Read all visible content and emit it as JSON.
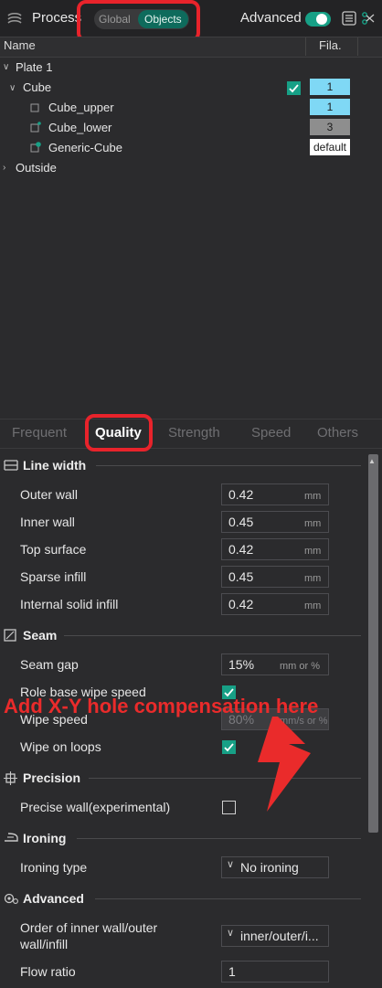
{
  "header": {
    "title": "Process",
    "toggle": {
      "global": "Global",
      "objects": "Objects"
    },
    "advanced_label": "Advanced"
  },
  "tree": {
    "columns": {
      "name": "Name",
      "fila": "Fila."
    },
    "rows": [
      {
        "label": "Plate 1",
        "fila": ""
      },
      {
        "label": "Cube",
        "fila": "1"
      },
      {
        "label": "Cube_upper",
        "fila": "1"
      },
      {
        "label": "Cube_lower",
        "fila": "3"
      },
      {
        "label": "Generic-Cube",
        "fila": "default"
      },
      {
        "label": "Outside",
        "fila": ""
      }
    ]
  },
  "tabs": [
    "Frequent",
    "Quality",
    "Strength",
    "Speed",
    "Others"
  ],
  "sections": {
    "line_width": {
      "title": "Line width",
      "options": [
        {
          "label": "Outer wall",
          "value": "0.42",
          "unit": "mm"
        },
        {
          "label": "Inner wall",
          "value": "0.45",
          "unit": "mm"
        },
        {
          "label": "Top surface",
          "value": "0.42",
          "unit": "mm"
        },
        {
          "label": "Sparse infill",
          "value": "0.45",
          "unit": "mm"
        },
        {
          "label": "Internal solid infill",
          "value": "0.42",
          "unit": "mm"
        }
      ]
    },
    "seam": {
      "title": "Seam",
      "seam_gap": {
        "label": "Seam gap",
        "value": "15%",
        "unit": "mm or %"
      },
      "role_base": {
        "label": "Role base wipe speed"
      },
      "wipe_speed": {
        "label": "Wipe speed",
        "value": "80%",
        "unit": "mm/s or %"
      },
      "wipe_loops": {
        "label": "Wipe on loops"
      }
    },
    "precision": {
      "title": "Precision",
      "precise_wall": {
        "label": "Precise wall(experimental)"
      }
    },
    "ironing": {
      "title": "Ironing",
      "ironing_type": {
        "label": "Ironing type",
        "value": "No ironing"
      }
    },
    "advanced": {
      "title": "Advanced",
      "order": {
        "label_line1": "Order of inner wall/outer",
        "label_line2": "wall/infill",
        "value": "inner/outer/i..."
      },
      "flow_ratio": {
        "label": "Flow ratio",
        "value": "1"
      }
    }
  },
  "annotation": "Add X-Y hole compensation here",
  "colors": {
    "accent": "#17a086",
    "objects_pill": "#0e6b5c",
    "fila_1": "#7fd8f5",
    "fila_3": "#8e8e8e",
    "annotation_red": "#e8232b"
  }
}
